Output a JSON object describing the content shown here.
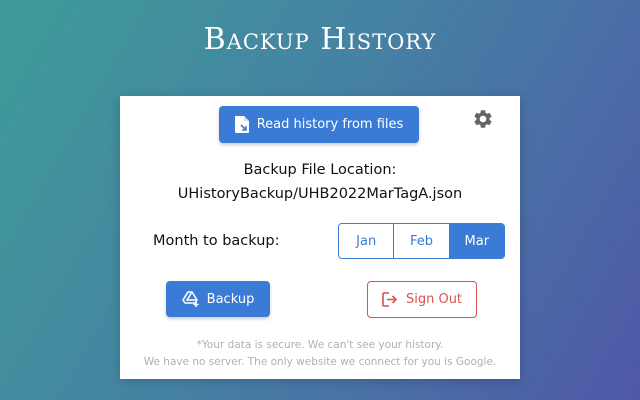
{
  "header": {
    "title": "Backup History"
  },
  "toolbar": {
    "read_button_label": "Read history from files",
    "read_button_icon": "file-import-icon",
    "settings_icon": "gear-icon"
  },
  "location": {
    "label": "Backup File Location:",
    "path": "UHistoryBackup/UHB2022MarTagA.json"
  },
  "month": {
    "label": "Month to backup:",
    "options": [
      "Jan",
      "Feb",
      "Mar"
    ],
    "selected": "Mar"
  },
  "actions": {
    "backup_label": "Backup",
    "backup_icon": "drive-add-icon",
    "signout_label": "Sign Out",
    "signout_icon": "sign-out-icon"
  },
  "notes": {
    "line1": "*Your data is secure. We can't see your history.",
    "line2": "We have no server. The only website we connect for you is Google."
  },
  "colors": {
    "primary": "#3a7bd5",
    "danger": "#d9534f",
    "muted_text": "#b0b0b0"
  }
}
